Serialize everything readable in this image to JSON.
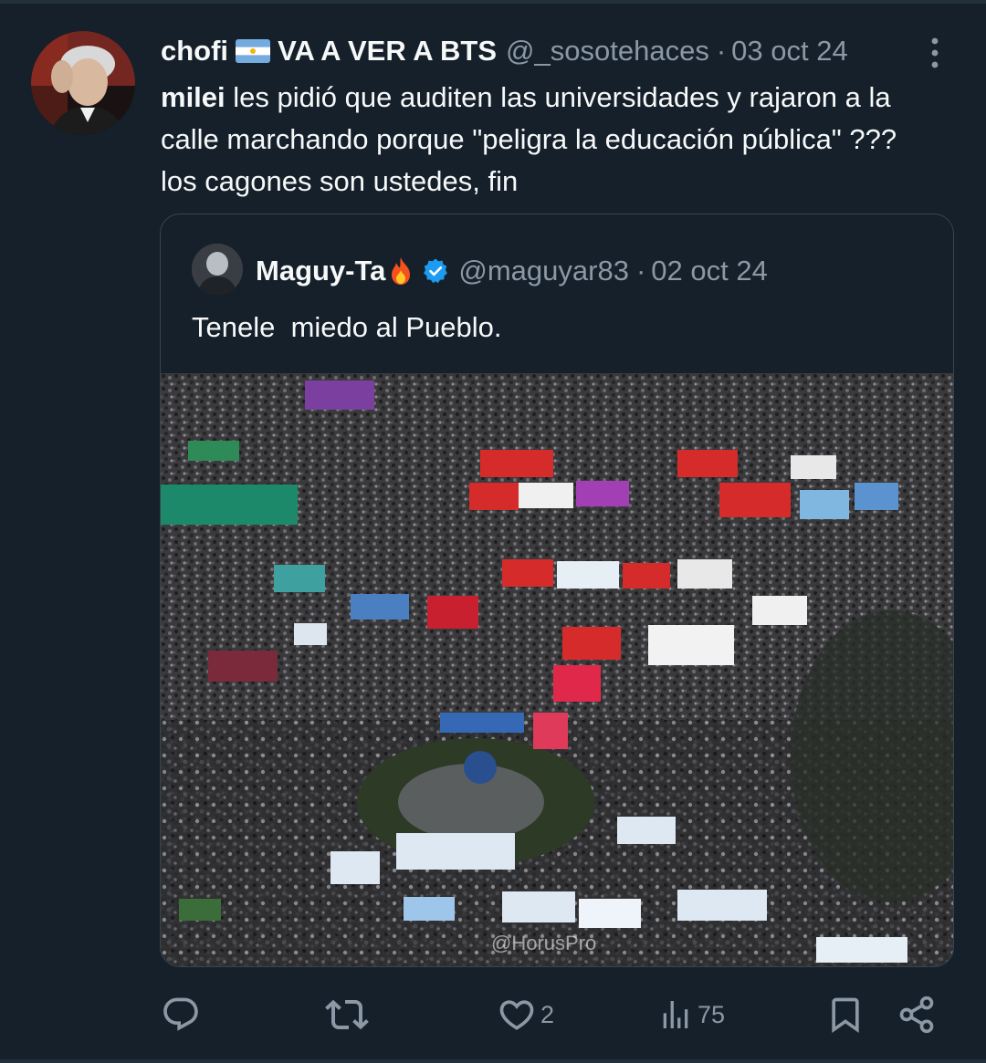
{
  "tweet": {
    "display_name": "chofi",
    "display_name_suffix": "VA A VER A BTS",
    "flag_icon": "argentina-flag-emoji",
    "handle": "@_sosotehaces",
    "separator": "·",
    "date": "03 oct 24",
    "text_mention": "milei",
    "text_line_1_rest": " les pidió que auditen las universidades y rajaron a la",
    "text_line_2": "calle marchando porque \"peligra la educación pública\" ???",
    "text_line_3": "los cagones son ustedes, fin"
  },
  "quoted": {
    "display_name": "Maguy-Ta",
    "emoji_icon": "fire-emoji",
    "verified_icon": "verified-badge-icon",
    "handle": "@maguyar83",
    "separator": "·",
    "date": "02 oct 24",
    "text": "Tenele  miedo al Pueblo.",
    "media": {
      "description_icon": "protest-crowd-photo",
      "watermark": "@HorusPro"
    }
  },
  "actions": {
    "reply": {
      "icon": "reply-icon",
      "count": ""
    },
    "retweet": {
      "icon": "retweet-icon",
      "count": ""
    },
    "like": {
      "icon": "heart-icon",
      "count": "2"
    },
    "views": {
      "icon": "views-icon",
      "count": "75"
    },
    "bookmark": {
      "icon": "bookmark-icon"
    },
    "share": {
      "icon": "share-icon"
    }
  },
  "colors": {
    "background": "#15202b",
    "text_primary": "#f7f9f9",
    "text_secondary": "#8b98a5",
    "border": "#38444d",
    "verified_blue": "#1d9bf0"
  }
}
